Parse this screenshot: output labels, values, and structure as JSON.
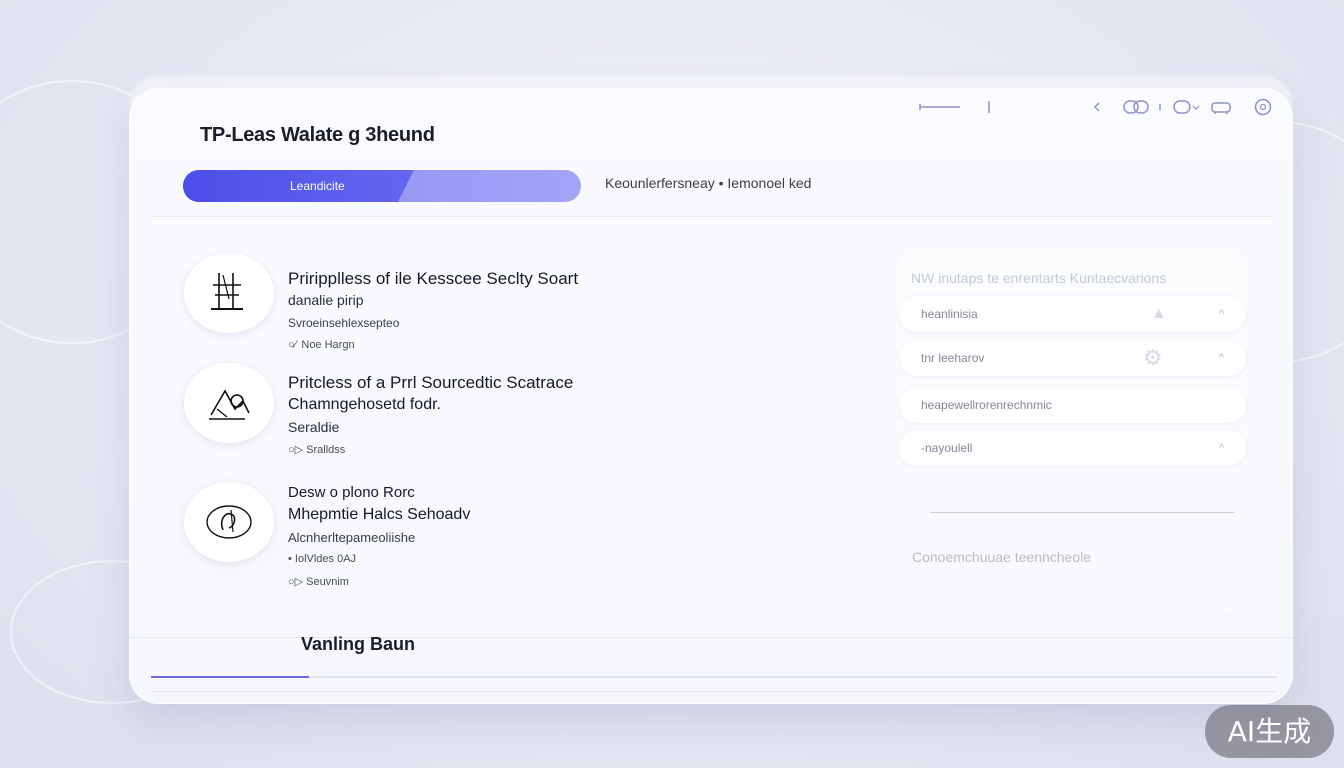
{
  "app": {
    "title": "TP-Leas Walate g 3heund"
  },
  "toolbar": {
    "icons": [
      "minus-line-icon",
      "divider-icon",
      "chevron-left-icon",
      "link-icon",
      "dot-icon",
      "link-icon",
      "car-icon",
      "help-icon"
    ]
  },
  "progress": {
    "label": "Leandicite",
    "fraction": 0.58
  },
  "status": {
    "text": "Keounlerfersneay • Iemonoel ked"
  },
  "courses": [
    {
      "icon": "tower-icon",
      "title": "Priripplless of ile Kesscee Seclty Soart",
      "subtitle": "danalie pirip",
      "detail": "Svroeinsehlexsepteo",
      "meta": "○⁄  Noe Hargn"
    },
    {
      "icon": "tools-icon",
      "title": "Pritcless of a Prrl Sourcedtic Scatrace",
      "subtitle": "Chamngehosetd fodr.",
      "detail": "Seraldie",
      "meta": "○▷ Sralldss"
    },
    {
      "icon": "badge-icon",
      "title": "Desw o plono Rorc",
      "subtitle": "Mhepmtie Halcs Sehoadv",
      "detail": "Alcnherltepameoliishe",
      "extra": "• IolVldes   0AJ",
      "meta": "○▷ Seuvnim"
    }
  ],
  "side": {
    "heading": "NW inutaps te enrentarts Kuntaecvarions",
    "rows": [
      {
        "label": "heanlinisia",
        "chev": "^"
      },
      {
        "label": "tnr leeharov",
        "chev": "^"
      },
      {
        "label": "heapewellrorenrechnmic",
        "chev": ""
      },
      {
        "label": "-nayoulell",
        "chev": "^"
      }
    ],
    "footer": "Conoemchuuae teenncheole"
  },
  "bottom": {
    "title": "Vanling Baun",
    "fraction": 0.14
  },
  "badge": {
    "text": "AI生成"
  }
}
